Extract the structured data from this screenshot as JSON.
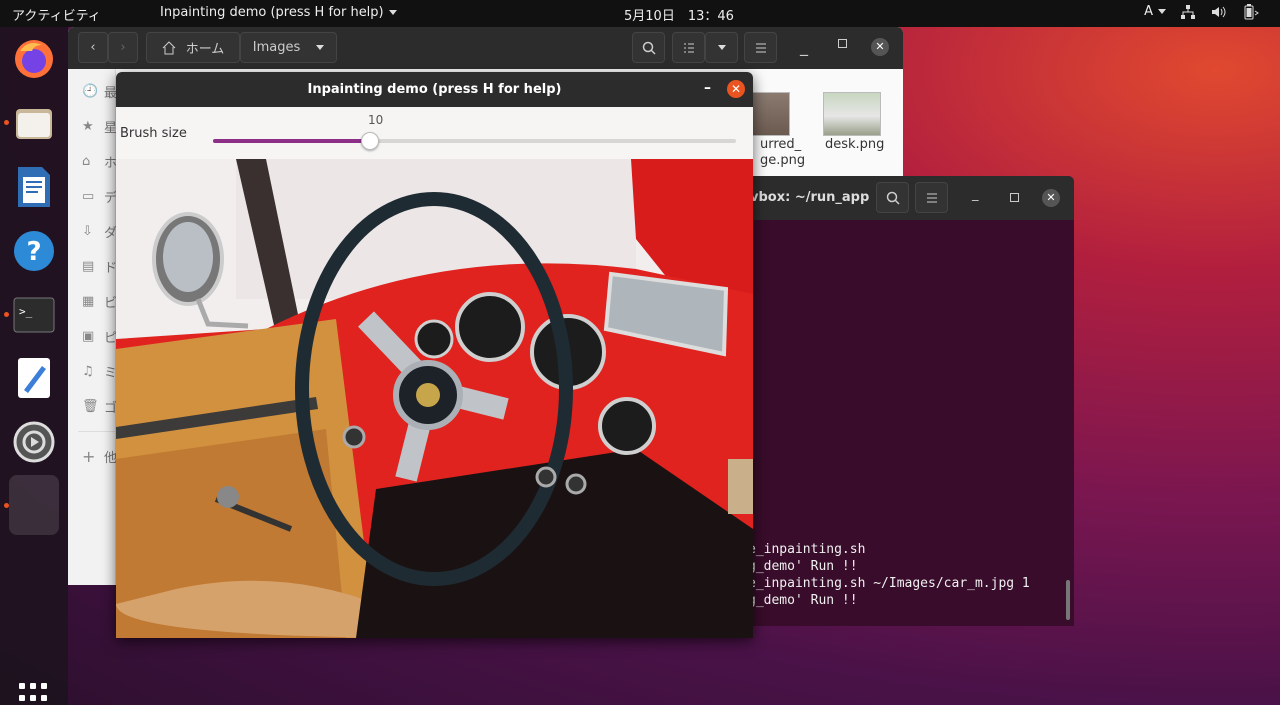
{
  "topbar": {
    "activities": "アクティビティ",
    "app_menu": "Inpainting demo (press H for help)",
    "clock": "5月10日　13：46",
    "input_method": "A"
  },
  "dock": {
    "items": [
      "firefox-icon",
      "files-icon",
      "writer-icon",
      "help-icon",
      "terminal-icon",
      "text-editor-icon",
      "settings-icon",
      "running-app-icon"
    ]
  },
  "files": {
    "breadcrumb_home": "ホーム",
    "breadcrumb_current": "Images",
    "sidebar": [
      {
        "icon": "clock-icon",
        "label": "最"
      },
      {
        "icon": "star-icon",
        "label": "星"
      },
      {
        "icon": "home-icon",
        "label": "ホ"
      },
      {
        "icon": "desktop-icon",
        "label": "デ"
      },
      {
        "icon": "download-icon",
        "label": "ダ"
      },
      {
        "icon": "document-icon",
        "label": "ド"
      },
      {
        "icon": "video-icon",
        "label": "ビ"
      },
      {
        "icon": "picture-icon",
        "label": "ピ"
      },
      {
        "icon": "music-icon",
        "label": "ミ"
      },
      {
        "icon": "trash-icon",
        "label": "ゴ"
      },
      {
        "icon": "plus-icon",
        "label": "他"
      }
    ],
    "file1_label_a": "urred_",
    "file1_label_b": "ge.png",
    "file2_label": "desk.png"
  },
  "terminal": {
    "title": "vbox: ~/run_app",
    "lines": [
      "e_inpainting.sh",
      "g_demo' Run !!",
      "e_inpainting.sh ~/Images/car_m.jpg 1",
      "g_demo' Run !!"
    ]
  },
  "inpaint": {
    "title": "Inpainting demo (press H for help)",
    "brush_label": "Brush size",
    "brush_value": "10",
    "brush_fraction": 0.3
  },
  "colors": {
    "accent": "#e95420",
    "slider": "#8c2f87"
  }
}
